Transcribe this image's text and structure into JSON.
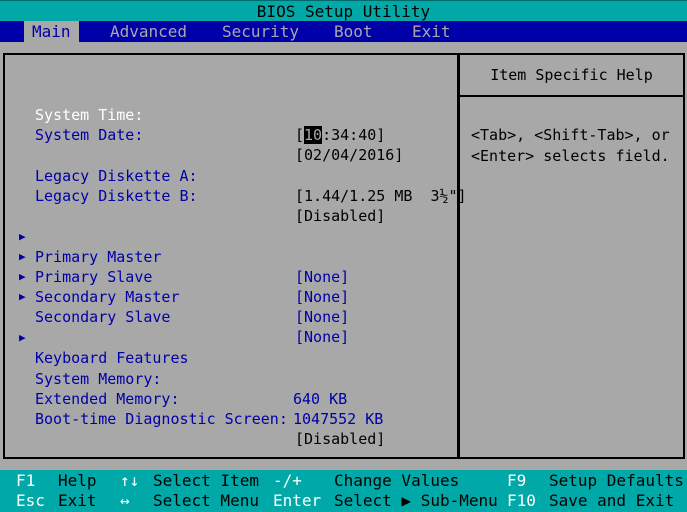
{
  "title": "BIOS Setup Utility",
  "tabs": [
    {
      "label": "Main",
      "active": true
    },
    {
      "label": "Advanced",
      "active": false
    },
    {
      "label": "Security",
      "active": false
    },
    {
      "label": "Boot",
      "active": false
    },
    {
      "label": "Exit",
      "active": false
    }
  ],
  "settings": {
    "system_time": {
      "label": "System Time:",
      "bracket_open": "[",
      "hour": "10",
      "rest": ":34:40]"
    },
    "system_date": {
      "label": "System Date:",
      "value": "[02/04/2016]"
    },
    "diskette_a": {
      "label": "Legacy Diskette A:",
      "value": "[1.44/1.25 MB  3½\"]"
    },
    "diskette_b": {
      "label": "Legacy Diskette B:",
      "value": "[Disabled]"
    },
    "submenus": [
      {
        "label": "Primary Master",
        "value": "[None]"
      },
      {
        "label": "Primary Slave",
        "value": "[None]"
      },
      {
        "label": "Secondary Master",
        "value": "[None]"
      },
      {
        "label": "Secondary Slave",
        "value": "[None]"
      }
    ],
    "keyboard_features": {
      "label": "Keyboard Features"
    },
    "system_memory": {
      "label": "System Memory:",
      "value": "640 KB"
    },
    "extended_memory": {
      "label": "Extended Memory:",
      "value": "1047552 KB"
    },
    "boot_diag": {
      "label": "Boot-time Diagnostic Screen:",
      "value": "[Disabled]"
    },
    "arrow_glyph": "▶"
  },
  "help": {
    "title": "Item Specific Help",
    "text": "<Tab>, <Shift-Tab>, or\n<Enter> selects field."
  },
  "footer": {
    "row1": [
      {
        "key": "F1",
        "desc": "Help"
      },
      {
        "key": "↑↓",
        "desc": "Select Item"
      },
      {
        "key": "-/+",
        "desc": "Change Values"
      },
      {
        "key": "F9",
        "desc": "Setup Defaults"
      }
    ],
    "row2": [
      {
        "key": "Esc",
        "desc": "Exit"
      },
      {
        "key": "↔",
        "desc": "Select Menu"
      },
      {
        "key": "Enter",
        "desc": "Select ▶ Sub-Menu"
      },
      {
        "key": "F10",
        "desc": "Save and Exit"
      }
    ]
  },
  "colors": {
    "title_bg": "#00a8a8",
    "menu_bg": "#0000a8",
    "panel_bg": "#a8a8a8",
    "label_blue": "#0000a8",
    "selected_white": "#ffffff"
  }
}
